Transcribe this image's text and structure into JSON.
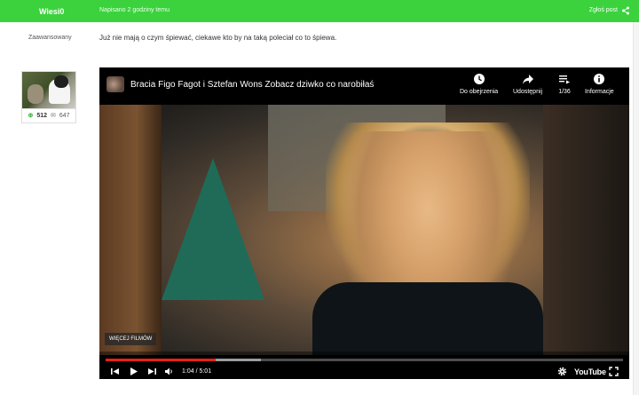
{
  "post": {
    "author": "Wiesi0",
    "posted": "Napisano 2 godziny temu",
    "report": "Zgłoś post",
    "text": "Już nie mają o czym śpiewać, ciekawe kto by na taką poleciał co to śpiewa."
  },
  "user": {
    "rank": "Zaawansowany",
    "reputation": "512",
    "posts": "647"
  },
  "video": {
    "title": "Bracia Figo Fagot i Sztefan Wons Zobacz dziwko co narobiłaś",
    "buttons": {
      "watch_later": "Do obejrzenia",
      "share": "Udostępnij",
      "playlist": "1/36",
      "info": "Informacje"
    },
    "more_videos": "WIĘCEJ FILMÓW",
    "time": "1:04 / 5:01",
    "progress": 0.2126,
    "logo": "YouTube"
  },
  "colors": {
    "accent": "#3bd23d",
    "progress": "#e62117"
  }
}
